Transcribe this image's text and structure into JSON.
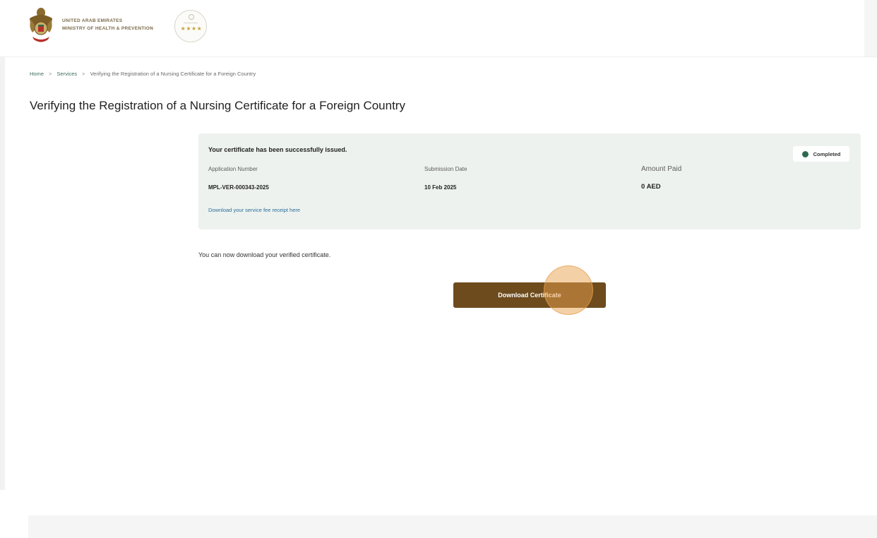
{
  "header": {
    "ministry_line1": "UNITED ARAB EMIRATES",
    "ministry_line2": "MINISTRY OF HEALTH & PREVENTION",
    "rating_stars": "★★★★"
  },
  "breadcrumb": {
    "items": [
      "Home",
      "Services",
      "Verifying the Registration of a Nursing Certificate for a Foreign Country"
    ],
    "separator": ">"
  },
  "page": {
    "title": "Verifying the Registration of a Nursing Certificate for a Foreign Country"
  },
  "status_card": {
    "heading": "Your certificate has been successfully issued.",
    "status": "Completed",
    "fields": [
      {
        "label": "Application Number",
        "value": "MPL-VER-000343-2025"
      },
      {
        "label": "Submission Date",
        "value": "10 Feb 2025"
      },
      {
        "label": "Amount Paid",
        "value": "0 AED"
      }
    ],
    "receipt_link": "Download your service fee receipt here"
  },
  "download": {
    "info": "You can now download your verified certificate.",
    "button_label": "Download Certificate"
  },
  "colors": {
    "brand_brown": "#6d4b1d",
    "card_bg": "#edf2ee",
    "status_green": "#2f6a4e",
    "link_blue": "#2b6e9c",
    "click_highlight": "#e9a14e"
  }
}
